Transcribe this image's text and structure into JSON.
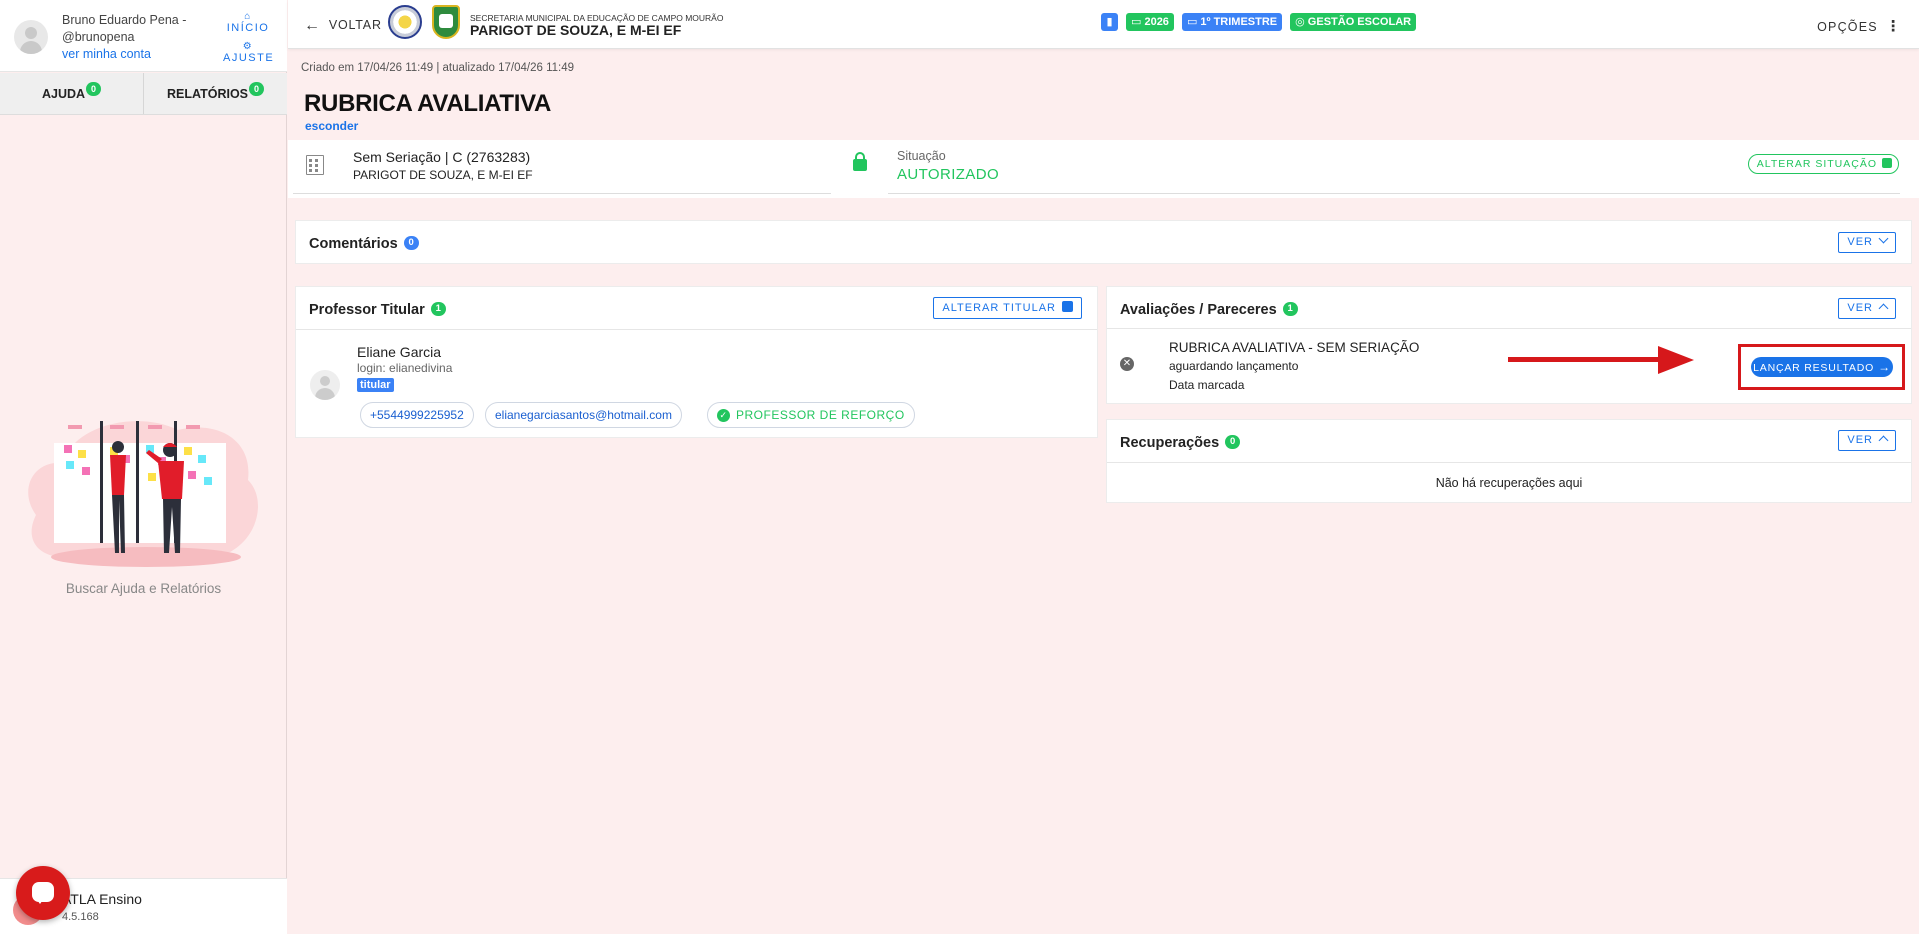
{
  "sidebar": {
    "user_name": "Bruno Eduardo Pena - @brunopena",
    "account_link": "ver minha conta",
    "home_label": "INÍCIO",
    "settings_label": "AJUSTE",
    "tabs": [
      {
        "label": "AJUDA",
        "count": "0"
      },
      {
        "label": "RELATÓRIOS",
        "count": "0"
      }
    ],
    "help_text": "Buscar Ajuda e Relatórios",
    "brand": "ATLA Ensino",
    "version": "4.5.168"
  },
  "topbar": {
    "back_label": "VOLTAR",
    "org_subtitle": "SECRETARIA MUNICIPAL DA EDUCAÇÃO DE CAMPO MOURÃO",
    "org_title": "PARIGOT DE SOUZA, E M-EI EF",
    "year_badge": "2026",
    "term_badge": "1º TRIMESTRE",
    "mode_badge": "GESTÃO ESCOLAR",
    "options_label": "OPÇÕES"
  },
  "header": {
    "created": "Criado em 17/04/26 11:49 | atualizado 17/04/26 11:49",
    "title": "RUBRICA AVALIATIVA",
    "hide_link": "esconder"
  },
  "info": {
    "class_name": "Sem Seriação | C (2763283)",
    "school": "PARIGOT DE SOUZA, E M-EI EF",
    "status_label": "Situação",
    "status_value": "AUTORIZADO",
    "change_status_label": "ALTERAR SITUAÇÃO"
  },
  "comments": {
    "title": "Comentários",
    "count": "0",
    "ver_label": "VER"
  },
  "teacher": {
    "title": "Professor Titular",
    "count": "1",
    "change_label": "ALTERAR TITULAR",
    "name": "Eliane Garcia",
    "login": "login: elianedivina",
    "tag": "titular",
    "phone": "+5544999225952",
    "email": "elianegarciasantos@hotmail.com",
    "role": "PROFESSOR DE REFORÇO"
  },
  "evaluations": {
    "title": "Avaliações / Pareceres",
    "count": "1",
    "ver_label": "VER",
    "item_title": "RUBRICA AVALIATIVA - SEM SERIAÇÃO",
    "item_status": "aguardando lançamento",
    "item_date": "Data marcada",
    "launch_label": "LANÇAR RESULTADO"
  },
  "recoveries": {
    "title": "Recuperações",
    "count": "0",
    "ver_label": "VER",
    "empty_text": "Não há recuperações aqui"
  },
  "colors": {
    "accent": "#1a73e8",
    "success": "#22c55e",
    "highlight": "#d6181b",
    "background": "#fdeeee"
  }
}
